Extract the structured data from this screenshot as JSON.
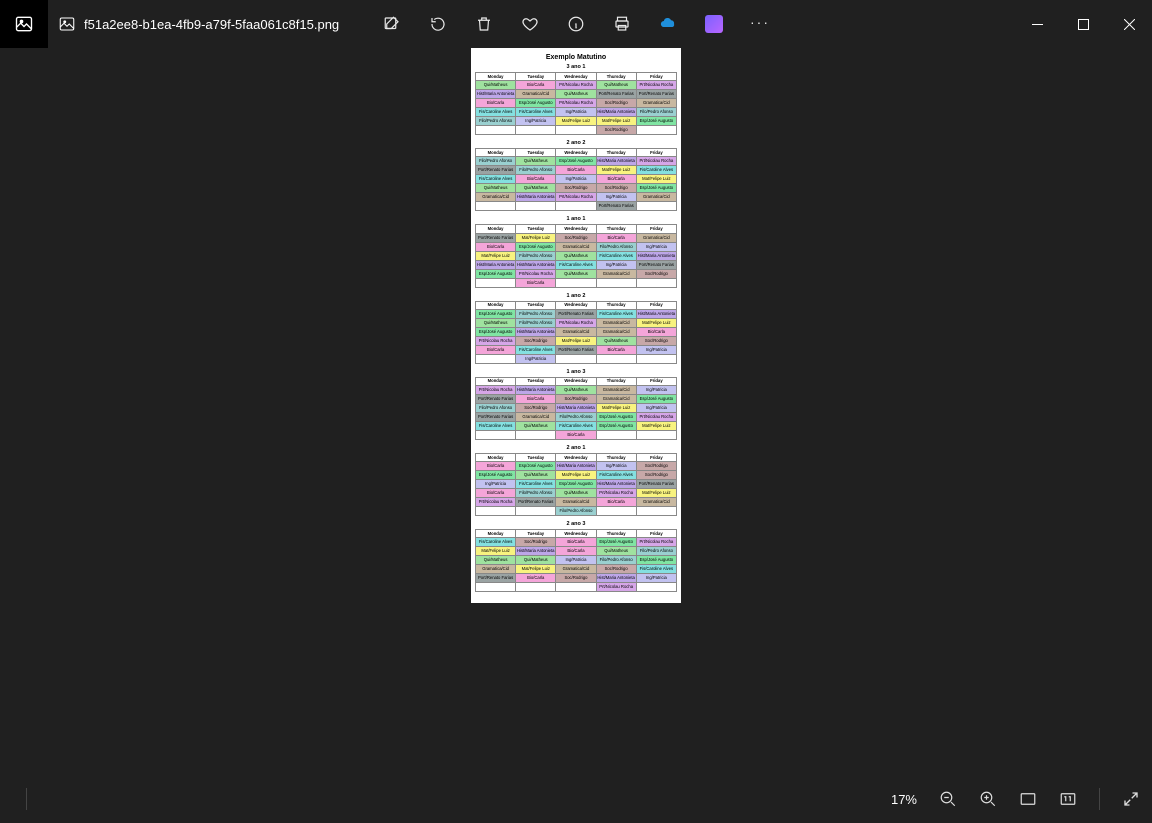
{
  "header": {
    "filename": "f51a2ee8-b1ea-4fb9-a79f-5faa061c8f15.png"
  },
  "toolbar_icons": [
    "edit",
    "rotate",
    "delete",
    "heart",
    "info",
    "print",
    "onedrive",
    "clipchamp",
    "more"
  ],
  "window_controls": [
    "minimize",
    "maximize",
    "close"
  ],
  "bottombar": {
    "zoom_text": "17%",
    "icons": [
      "zoom-out",
      "zoom-in",
      "fit",
      "actual",
      "fullscreen"
    ]
  },
  "doc": {
    "title": "Exemplo Matutino",
    "days": [
      "Monday",
      "Tuesday",
      "Wednesday",
      "Thursday",
      "Friday"
    ],
    "groups": [
      {
        "name": "3 ano 1",
        "rows": [
          [
            "Qui/Matheus",
            "Bio/Carla",
            "Prt/Nicolau Rocha",
            "Qui/Matheus",
            "Prt/Nicolau Rocha"
          ],
          [
            "Hist/Maria Antonieta",
            "Gramatica/Cid",
            "Qui/Matheus",
            "Port/Renato Farias",
            "Port/Renato Farias"
          ],
          [
            "Bio/Carla",
            "Esp/José Augusto",
            "Prt/Nicolau Rocha",
            "Soc/Rodrigo",
            "Gramatica/Cid"
          ],
          [
            "Fis/Caroline Alves",
            "Fis/Caroline Alves",
            "Ing/Patricia",
            "Hist/Maria Antonieta",
            "Filo/Pedro Afonso"
          ],
          [
            "Filo/Pedro Afonso",
            "Ing/Patricia",
            "Mat/Felipe Luiz",
            "Mat/Felipe Luiz",
            "Esp/José Augusto"
          ],
          [
            "",
            "",
            "",
            "Soc/Rodrigo",
            ""
          ]
        ]
      },
      {
        "name": "2 ano 2",
        "rows": [
          [
            "Filo/Pedro Afonso",
            "Qui/Matheus",
            "Esp/José Augusto",
            "Hist/Maria Antonieta",
            "Prt/Nicolau Rocha"
          ],
          [
            "Port/Renato Farias",
            "Filo/Pedro Afonso",
            "Bio/Carla",
            "Mat/Felipe Luiz",
            "Fis/Caroline Alves"
          ],
          [
            "Fis/Caroline Alves",
            "Bio/Carla",
            "Ing/Patricia",
            "Bio/Carla",
            "Mat/Felipe Luiz"
          ],
          [
            "Qui/Matheus",
            "Qui/Matheus",
            "Soc/Rodrigo",
            "Soc/Rodrigo",
            "Esp/José Augusto"
          ],
          [
            "Gramatica/Cid",
            "Hist/Maria Antonieta",
            "Prt/Nicolau Rocha",
            "Ing/Patricia",
            "Gramatica/Cid"
          ],
          [
            "",
            "",
            "",
            "Port/Renato Farias",
            ""
          ]
        ]
      },
      {
        "name": "1 ano 1",
        "rows": [
          [
            "Port/Renato Farias",
            "Mat/Felipe Luiz",
            "Soc/Rodrigo",
            "Bio/Carla",
            "Gramatica/Cid"
          ],
          [
            "Bio/Carla",
            "Esp/José Augusto",
            "Gramatica/Cid",
            "Filo/Pedro Afonso",
            "Ing/Patricia"
          ],
          [
            "Mat/Felipe Luiz",
            "Filo/Pedro Afonso",
            "Qui/Matheus",
            "Fis/Caroline Alves",
            "Hist/Maria Antonieta"
          ],
          [
            "Hist/Maria Antonieta",
            "Hist/Maria Antonieta",
            "Fis/Caroline Alves",
            "Ing/Patricia",
            "Port/Renato Farias"
          ],
          [
            "Esp/José Augusto",
            "Prt/Nicolau Rocha",
            "Qui/Matheus",
            "Gramatica/Cid",
            "Soc/Rodrigo"
          ],
          [
            "",
            "Bio/Carla",
            "",
            "",
            ""
          ]
        ]
      },
      {
        "name": "1 ano 2",
        "rows": [
          [
            "Esp/José Augusto",
            "Filo/Pedro Afonso",
            "Port/Renato Farias",
            "Fis/Caroline Alves",
            "Hist/Maria Antonieta"
          ],
          [
            "Qui/Matheus",
            "Filo/Pedro Afonso",
            "Prt/Nicolau Rocha",
            "Gramatica/Cid",
            "Mat/Felipe Luiz"
          ],
          [
            "Esp/José Augusto",
            "Hist/Maria Antonieta",
            "Gramatica/Cid",
            "Gramatica/Cid",
            "Bio/Carla"
          ],
          [
            "Prt/Nicolau Rocha",
            "Soc/Rodrigo",
            "Mat/Felipe Luiz",
            "Qui/Matheus",
            "Soc/Rodrigo"
          ],
          [
            "Bio/Carla",
            "Fis/Caroline Alves",
            "Port/Renato Farias",
            "Bio/Carla",
            "Ing/Patricia"
          ],
          [
            "",
            "Ing/Patricia",
            "",
            "",
            ""
          ]
        ]
      },
      {
        "name": "1 ano 3",
        "rows": [
          [
            "Prt/Nicolau Rocha",
            "Hist/Maria Antonieta",
            "Qui/Matheus",
            "Gramatica/Cid",
            "Ing/Patricia"
          ],
          [
            "Port/Renato Farias",
            "Bio/Carla",
            "Soc/Rodrigo",
            "Gramatica/Cid",
            "Esp/José Augusto"
          ],
          [
            "Filo/Pedro Afonso",
            "Soc/Rodrigo",
            "Hist/Maria Antonieta",
            "Mat/Felipe Luiz",
            "Ing/Patricia"
          ],
          [
            "Port/Renato Farias",
            "Gramatica/Cid",
            "Filo/Pedro Afonso",
            "Esp/José Augusto",
            "Prt/Nicolau Rocha"
          ],
          [
            "Fis/Caroline Alves",
            "Qui/Matheus",
            "Fis/Caroline Alves",
            "Esp/José Augusto",
            "Mat/Felipe Luiz"
          ],
          [
            "",
            "",
            "Bio/Carla",
            "",
            ""
          ]
        ]
      },
      {
        "name": "2 ano 1",
        "rows": [
          [
            "Bio/Carla",
            "Esp/José Augusto",
            "Hist/Maria Antonieta",
            "Ing/Patricia",
            "Soc/Rodrigo"
          ],
          [
            "Esp/José Augusto",
            "Qui/Matheus",
            "Mat/Felipe Luiz",
            "Fis/Caroline Alves",
            "Soc/Rodrigo"
          ],
          [
            "Ing/Patricia",
            "Fis/Caroline Alves",
            "Esp/José Augusto",
            "Hist/Maria Antonieta",
            "Port/Renato Farias"
          ],
          [
            "Bio/Carla",
            "Filo/Pedro Afonso",
            "Qui/Matheus",
            "Prt/Nicolau Rocha",
            "Mat/Felipe Luiz"
          ],
          [
            "Prt/Nicolau Rocha",
            "Port/Renato Farias",
            "Gramatica/Cid",
            "Bio/Carla",
            "Gramatica/Cid"
          ],
          [
            "",
            "",
            "Filo/Pedro Afonso",
            "",
            ""
          ]
        ]
      },
      {
        "name": "2 ano 3",
        "rows": [
          [
            "Fis/Caroline Alves",
            "Soc/Rodrigo",
            "Bio/Carla",
            "Esp/José Augusto",
            "Prt/Nicolau Rocha"
          ],
          [
            "Mat/Felipe Luiz",
            "Hist/Maria Antonieta",
            "Bio/Carla",
            "Qui/Matheus",
            "Filo/Pedro Afonso"
          ],
          [
            "Qui/Matheus",
            "Qui/Matheus",
            "Ing/Patricia",
            "Filo/Pedro Afonso",
            "Esp/José Augusto"
          ],
          [
            "Gramatica/Cid",
            "Mat/Felipe Luiz",
            "Gramatica/Cid",
            "Soc/Rodrigo",
            "Fis/Caroline Alves"
          ],
          [
            "Port/Renato Farias",
            "Bio/Carla",
            "Soc/Rodrigo",
            "Hist/Maria Antonieta",
            "Ing/Patricia"
          ],
          [
            "",
            "",
            "",
            "Prt/Nicolau Rocha",
            ""
          ]
        ]
      }
    ]
  }
}
